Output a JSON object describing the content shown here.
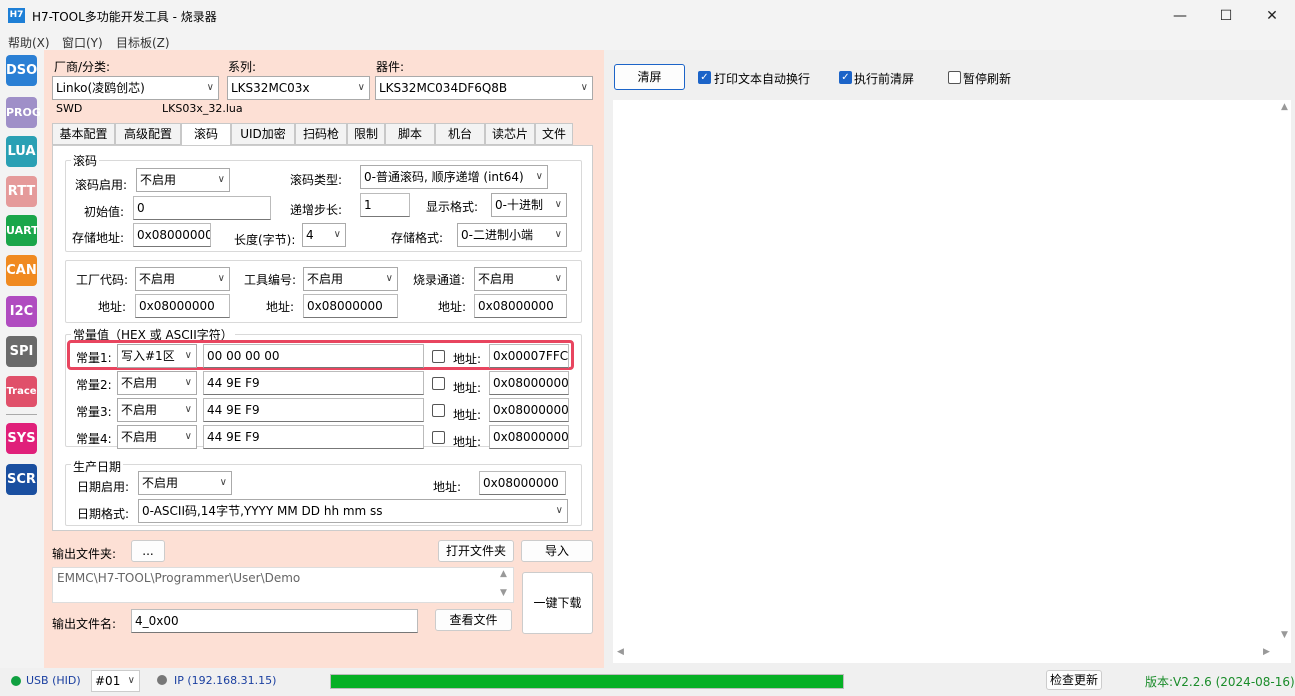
{
  "window": {
    "title": "H7-TOOL多功能开发工具 - 烧录器",
    "icon_text": "H7"
  },
  "menu": [
    "帮助(X)",
    "窗口(Y)",
    "目标板(Z)"
  ],
  "sidebar": [
    "DSO",
    "PROG",
    "LUA",
    "RTT",
    "UART",
    "CAN",
    "I2C",
    "SPI",
    "Trace",
    "SYS",
    "SCR"
  ],
  "sidebar_colors": [
    "#2a7fd4",
    "#9f8fc8",
    "#2aa0b4",
    "#e59a9a",
    "#1aa64a",
    "#f08a20",
    "#b04cc0",
    "#6a6a6a",
    "#e0506a",
    "#e0207a",
    "#1a4fa0"
  ],
  "selectors": {
    "vendor_label": "厂商/分类:",
    "vendor_value": "Linko(凌鸥创芯)",
    "series_label": "系列:",
    "series_value": "LKS32MC03x",
    "device_label": "器件:",
    "device_value": "LKS32MC034DF6Q8B",
    "interface": "SWD",
    "lua_file": "LKS03x_32.lua"
  },
  "tabs": [
    "基本配置",
    "高级配置",
    "滚码",
    "UID加密",
    "扫码枪",
    "限制",
    "脚本",
    "机台",
    "读芯片",
    "文件"
  ],
  "rolling": {
    "group": "滚码",
    "enable_label": "滚码启用:",
    "enable_value": "不启用",
    "type_label": "滚码类型:",
    "type_value": "0-普通滚码, 顺序递增 (int64)",
    "init_label": "初始值:",
    "init_value": "0",
    "step_label": "递增步长:",
    "step_value": "1",
    "disp_label": "显示格式:",
    "disp_value": "0-十进制",
    "addr_label": "存储地址:",
    "addr_value": "0x08000000",
    "len_label": "长度(字节):",
    "len_value": "4",
    "store_label": "存储格式:",
    "store_value": "0-二进制小端"
  },
  "codes": {
    "factory_label": "工厂代码:",
    "factory_value": "不启用",
    "tool_label": "工具编号:",
    "tool_value": "不启用",
    "channel_label": "烧录通道:",
    "channel_value": "不启用",
    "addr_label": "地址:",
    "factory_addr": "0x08000000",
    "tool_addr": "0x08000000",
    "channel_addr": "0x08000000"
  },
  "constants": {
    "group": "常量值（HEX 或 ASCII字符）",
    "addr_label": "地址:",
    "rows": [
      {
        "label": "常量1:",
        "mode": "写入#1区",
        "value": "00 00 00 00",
        "addr": "0x00007FFC"
      },
      {
        "label": "常量2:",
        "mode": "不启用",
        "value": "44 9E F9",
        "addr": "0x08000000"
      },
      {
        "label": "常量3:",
        "mode": "不启用",
        "value": "44 9E F9",
        "addr": "0x08000000"
      },
      {
        "label": "常量4:",
        "mode": "不启用",
        "value": "44 9E F9",
        "addr": "0x08000000"
      }
    ]
  },
  "date": {
    "group": "生产日期",
    "enable_label": "日期启用:",
    "enable_value": "不启用",
    "addr_label": "地址:",
    "addr_value": "0x08000000",
    "fmt_label": "日期格式:",
    "fmt_value": "0-ASCII码,14字节,YYYY MM DD hh mm ss"
  },
  "output": {
    "folder_label": "输出文件夹:",
    "browse": "...",
    "open_folder": "打开文件夹",
    "import": "导入",
    "path": "EMMC\\H7-TOOL\\Programmer\\User\\Demo",
    "name_label": "输出文件名:",
    "name_value": "4_0x00",
    "view_file": "查看文件",
    "download": "一键下载"
  },
  "right": {
    "clear": "清屏",
    "wrap": "打印文本自动换行",
    "clear_before": "执行前清屏",
    "pause": "暂停刷新"
  },
  "status": {
    "usb": "USB (HID)",
    "port": "#01",
    "ip": "IP (192.168.31.15)",
    "progress": 1.0,
    "update": "检查更新",
    "version": "版本:V2.2.6 (2024-08-16)"
  }
}
